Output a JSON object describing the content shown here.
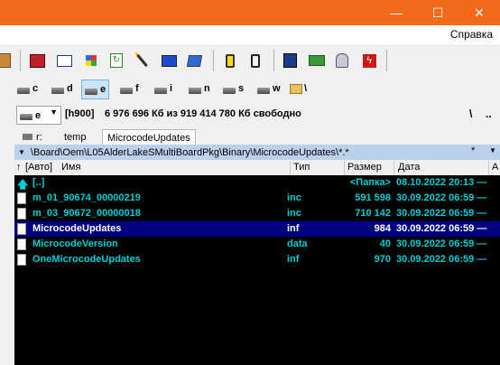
{
  "window": {
    "minimize_glyph": "—",
    "maximize_glyph": "☐",
    "close_glyph": "✕"
  },
  "menu": {
    "help": "Справка"
  },
  "drives": [
    {
      "letter": "c"
    },
    {
      "letter": "d"
    },
    {
      "letter": "e",
      "selected": true
    },
    {
      "letter": "f"
    },
    {
      "letter": "i"
    },
    {
      "letter": "n"
    },
    {
      "letter": "s"
    },
    {
      "letter": "w"
    }
  ],
  "root_symbol": "\\",
  "drive_combo": {
    "value": "e"
  },
  "volume_label": "[h900]",
  "free_space": "6 976 696 Кб из 919 414 780 Кб свободно",
  "path_root_button": "\\",
  "path_up_button": "..",
  "tabs": [
    {
      "label": "r:"
    },
    {
      "label": "temp"
    },
    {
      "label": "MicrocodeUpdates",
      "active": true
    }
  ],
  "current_path": "\\Board\\Oem\\L05AlderLakeSMultiBoardPkg\\Binary\\MicrocodeUpdates\\*.*",
  "path_star": "*",
  "columns": {
    "sort_prefix": "[Авто]",
    "name": "Имя",
    "type": "Тип",
    "size": "Размер",
    "date": "Дата",
    "attr": "А"
  },
  "files": [
    {
      "name": "[..]",
      "type": "",
      "size": "<Папка>",
      "date": "08.10.2022 20:13 —",
      "up": true
    },
    {
      "name": "m_01_90674_00000219",
      "type": "inc",
      "size": "591 598",
      "date": "30.09.2022 06:59 —"
    },
    {
      "name": "m_03_90672_00000018",
      "type": "inc",
      "size": "710 142",
      "date": "30.09.2022 06:59 —"
    },
    {
      "name": "MicrocodeUpdates",
      "type": "inf",
      "size": "984",
      "date": "30.09.2022 06:59 —",
      "selected": true
    },
    {
      "name": "MicrocodeVersion",
      "type": "data",
      "size": "40",
      "date": "30.09.2022 06:59 —"
    },
    {
      "name": "OneMicrocodeUpdates",
      "type": "inf",
      "size": "970",
      "date": "30.09.2022 06:59 —"
    }
  ]
}
